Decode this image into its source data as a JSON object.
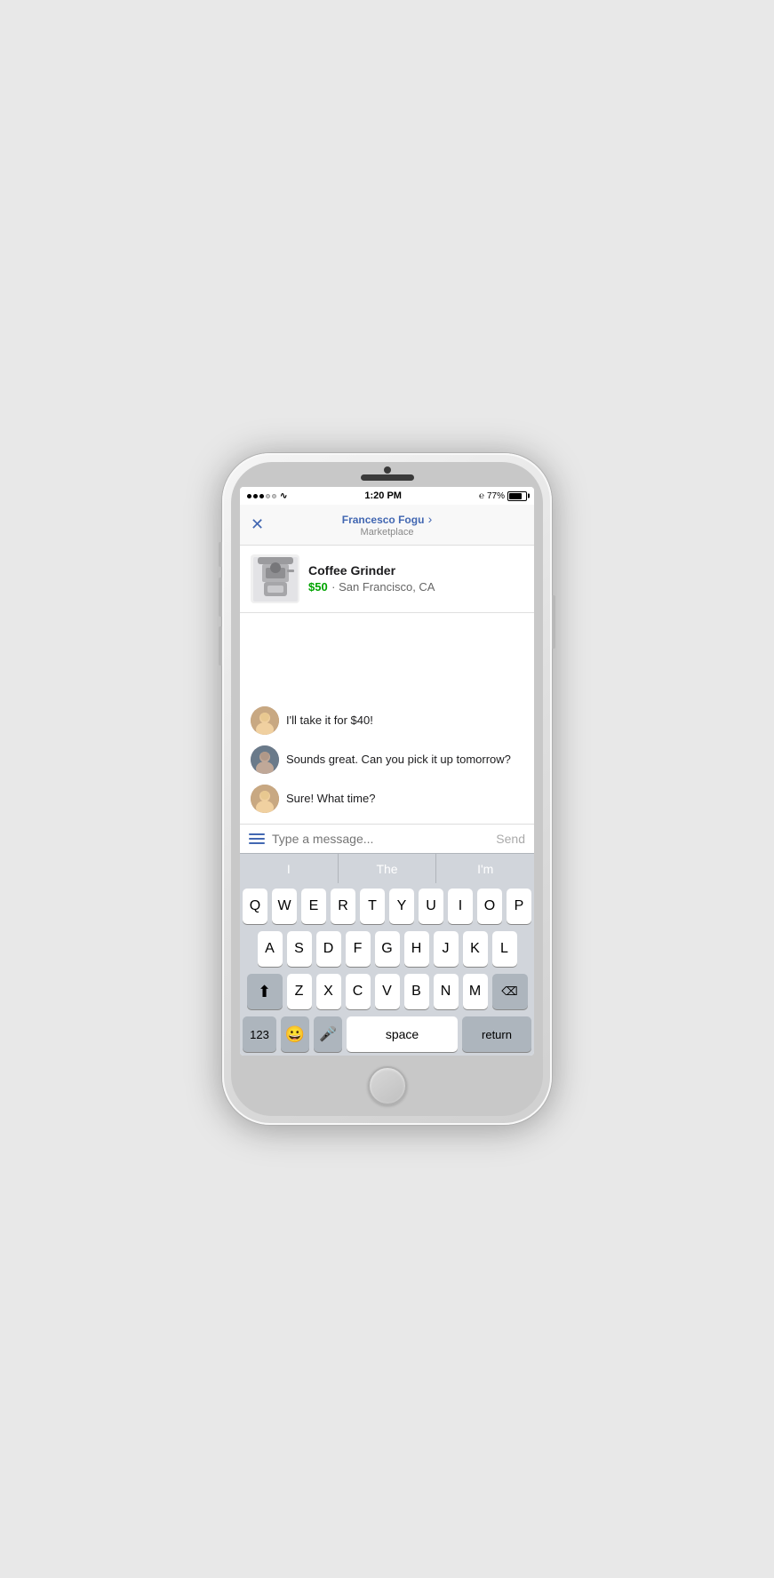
{
  "phone": {
    "status_bar": {
      "time": "1:20 PM",
      "battery_percent": "77%",
      "signal_filled": 3,
      "signal_empty": 2
    },
    "header": {
      "contact_name": "Francesco Fogu",
      "chevron": "›",
      "subtitle": "Marketplace",
      "close_icon": "✕"
    },
    "product": {
      "name": "Coffee Grinder",
      "price": "$50",
      "location": "· San Francisco, CA"
    },
    "messages": [
      {
        "id": "msg1",
        "sender": "buyer",
        "text": "I'll take it for $40!"
      },
      {
        "id": "msg2",
        "sender": "seller",
        "text": "Sounds great. Can you pick it up tomorrow?"
      },
      {
        "id": "msg3",
        "sender": "buyer",
        "text": "Sure! What time?"
      }
    ],
    "input": {
      "placeholder": "Type a message...",
      "send_label": "Send"
    },
    "predictive": {
      "words": [
        "I",
        "The",
        "I'm"
      ]
    },
    "keyboard": {
      "rows": [
        [
          "Q",
          "W",
          "E",
          "R",
          "T",
          "Y",
          "U",
          "I",
          "O",
          "P"
        ],
        [
          "A",
          "S",
          "D",
          "F",
          "G",
          "H",
          "J",
          "K",
          "L"
        ],
        [
          "⬆",
          "Z",
          "X",
          "C",
          "V",
          "B",
          "N",
          "M",
          "⌫"
        ],
        [
          "123",
          "😊",
          "🎤",
          "space",
          "return"
        ]
      ],
      "shift_label": "⬆",
      "backspace_label": "⌫",
      "numbers_label": "123",
      "space_label": "space",
      "return_label": "return"
    }
  }
}
